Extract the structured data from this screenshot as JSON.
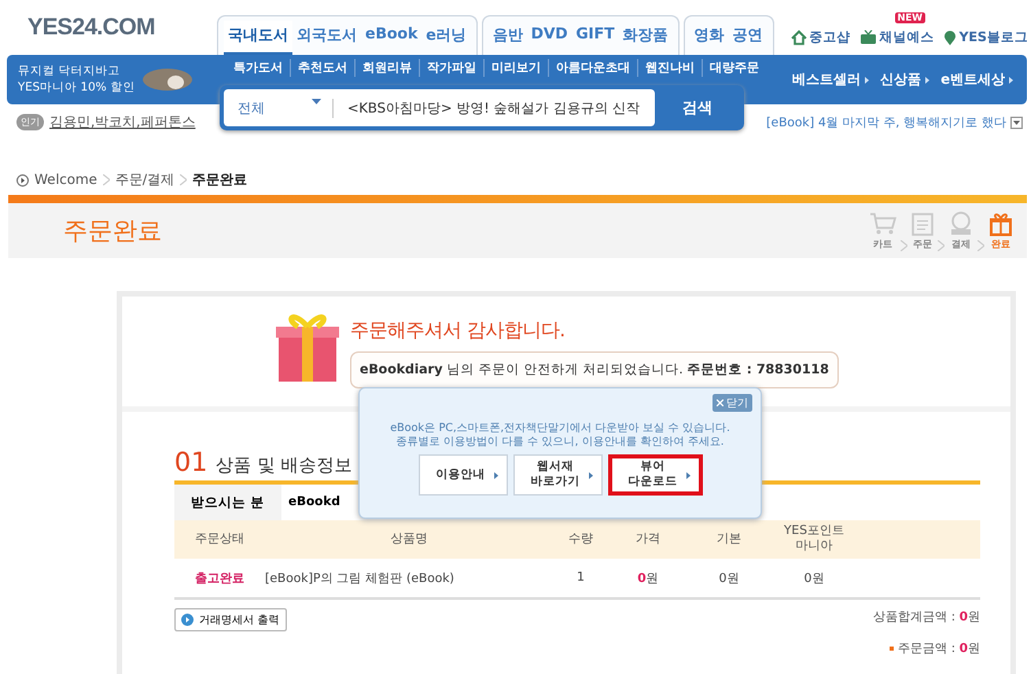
{
  "logo": "YES24.COM",
  "main_tabs": [
    [
      {
        "label": "국내도서",
        "selected": true
      },
      {
        "label": "외국도서",
        "selected": false
      },
      {
        "label": "eBook",
        "selected": false
      },
      {
        "label": "e러닝",
        "selected": false
      }
    ],
    [
      {
        "label": "음반",
        "selected": false
      },
      {
        "label": "DVD",
        "selected": false
      },
      {
        "label": "GIFT",
        "selected": false
      },
      {
        "label": "화장품",
        "selected": false
      }
    ],
    [
      {
        "label": "영화",
        "selected": false
      },
      {
        "label": "공연",
        "selected": false
      }
    ]
  ],
  "quick_links": [
    {
      "label": "중고샵",
      "kind": "house"
    },
    {
      "label": "채널예스",
      "kind": "tv",
      "badge": "NEW"
    },
    {
      "label": "YES블로그",
      "kind": "pin"
    }
  ],
  "banner": {
    "title": "뮤지컬 닥터지바고",
    "subtitle": "YES마니아 10% 할인"
  },
  "sub_nav": [
    "특가도서",
    "추천도서",
    "회원리뷰",
    "작가파일",
    "미리보기",
    "아름다운초대",
    "웹진나비",
    "대량주문"
  ],
  "right_nav": [
    "베스트셀러",
    "신상품",
    "e벤트세상"
  ],
  "search": {
    "category": "전체",
    "value": "<KBS아침마당> 방영! 숲해설가 김용규의 신작",
    "button": "검색"
  },
  "popular": {
    "badge": "인기",
    "keywords": "김용민,박코치,페퍼톤스"
  },
  "ticker": "[eBook] 4월 마지막 주, 행복해지기로 했다",
  "breadcrumb": [
    "Welcome",
    "주문/결제",
    "주문완료"
  ],
  "page_title": "주문완료",
  "steps": [
    {
      "label": "카트",
      "kind": "cart",
      "selected": false
    },
    {
      "label": "주문",
      "kind": "memo",
      "selected": false
    },
    {
      "label": "결제",
      "kind": "pay",
      "selected": false
    },
    {
      "label": "완료",
      "kind": "gift",
      "selected": true
    }
  ],
  "thanks": {
    "title": "주문해주셔서 감사합니다.",
    "message": "**eBookdiary** 님의 주문이 안전하게 처리되었습니다. **주문번호 : 78830118**"
  },
  "popup": {
    "close": "닫기",
    "lines": [
      "eBook은 PC,스마트폰,전자책단말기에서 다운받아 보실 수 있습니다.",
      "종류별로 이용방법이 다를 수 있으니, 이용안내를 확인하여 주세요."
    ],
    "buttons": [
      {
        "label": "이용안내",
        "selected": false
      },
      {
        "label": "웹서재\n바로가기",
        "selected": false
      },
      {
        "label": "뷰어\n다운로드",
        "selected": true
      }
    ]
  },
  "section": {
    "number": "01",
    "title": "상품 및 배송정보"
  },
  "recipient": {
    "label": "받으시는 분",
    "value": "eBookd"
  },
  "table": {
    "columns": [
      "주문상태",
      "상품명",
      "수량",
      "가격",
      "기본",
      "YES포인트\n마니아"
    ],
    "rows": [
      {
        "status": "출고완료",
        "name": "[eBook]P의 그림 체험판 (eBook)",
        "quantity": "1",
        "price": "**0**원",
        "points": "0원",
        "mania_points": "0원"
      }
    ]
  },
  "receipt_button": "거래명세서 출력",
  "totals": [
    {
      "text": "상품합계금액 : **0**원",
      "kind": "subtotal"
    },
    {
      "text": "주문금액 : **0**원",
      "kind": "total"
    }
  ]
}
